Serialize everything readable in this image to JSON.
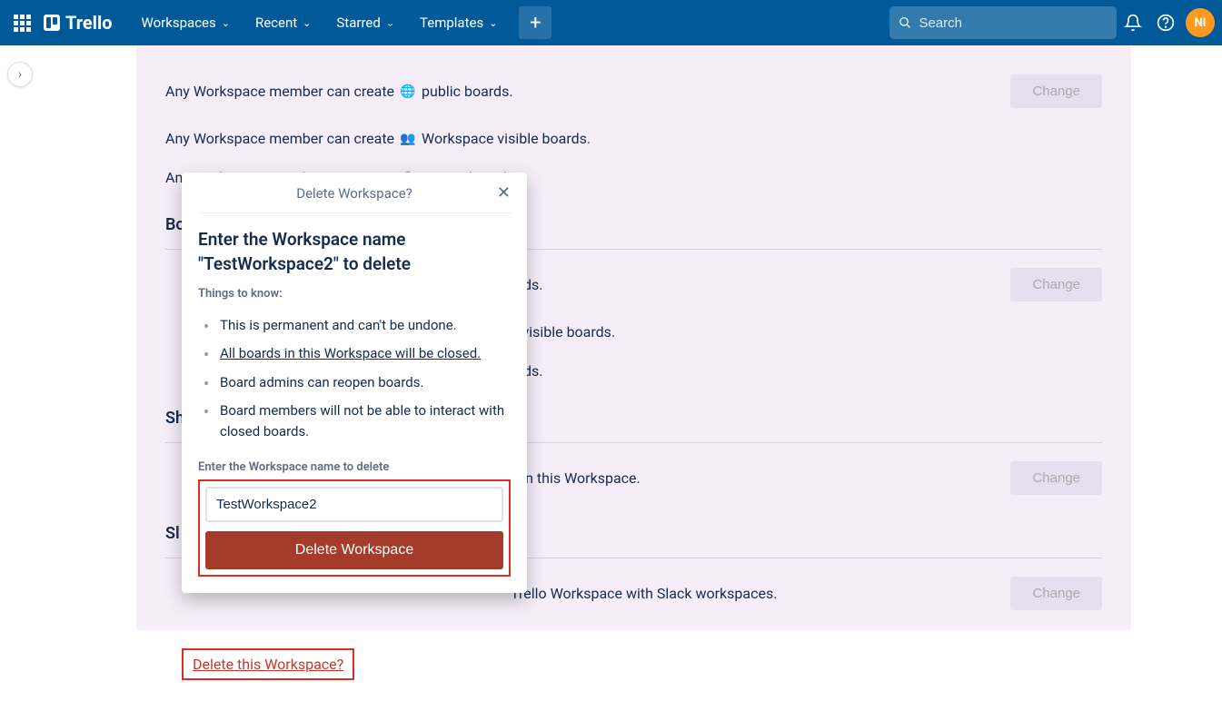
{
  "topbar": {
    "logo": "Trello",
    "nav": [
      "Workspaces",
      "Recent",
      "Starred",
      "Templates"
    ],
    "search_placeholder": "Search",
    "avatar": "NI"
  },
  "permissions": {
    "creation": [
      {
        "text_before": "Any Workspace member can create",
        "text_after": "public boards.",
        "icon": "public"
      },
      {
        "text_before": "Any Workspace member can create",
        "text_after": "Workspace visible boards.",
        "icon": "workspace"
      },
      {
        "text_before": "Any Workspace member can create",
        "text_after": "private boards.",
        "icon": "private"
      }
    ],
    "change_label": "Change"
  },
  "sections": {
    "deletion": {
      "heading": "Bo",
      "rows": [
        {
          "suffix": "ards."
        },
        {
          "suffix": "e visible boards."
        },
        {
          "suffix": "ards."
        }
      ]
    },
    "sharing": {
      "heading": "Sh",
      "row_suffix": "s in this Workspace."
    },
    "slack": {
      "heading": "Sl",
      "row_suffix": "Trello Workspace with Slack workspaces."
    }
  },
  "delete_link": "Delete this Workspace?",
  "popover": {
    "header": "Delete Workspace?",
    "title": "Enter the Workspace name \"TestWorkspace2\" to delete",
    "things_label": "Things to know:",
    "items": [
      "This is permanent and can't be undone.",
      "All boards in this Workspace will be closed.",
      "Board admins can reopen boards.",
      "Board members will not be able to interact with closed boards."
    ],
    "input_label": "Enter the Workspace name to delete",
    "input_value": "TestWorkspace2",
    "button": "Delete Workspace"
  }
}
